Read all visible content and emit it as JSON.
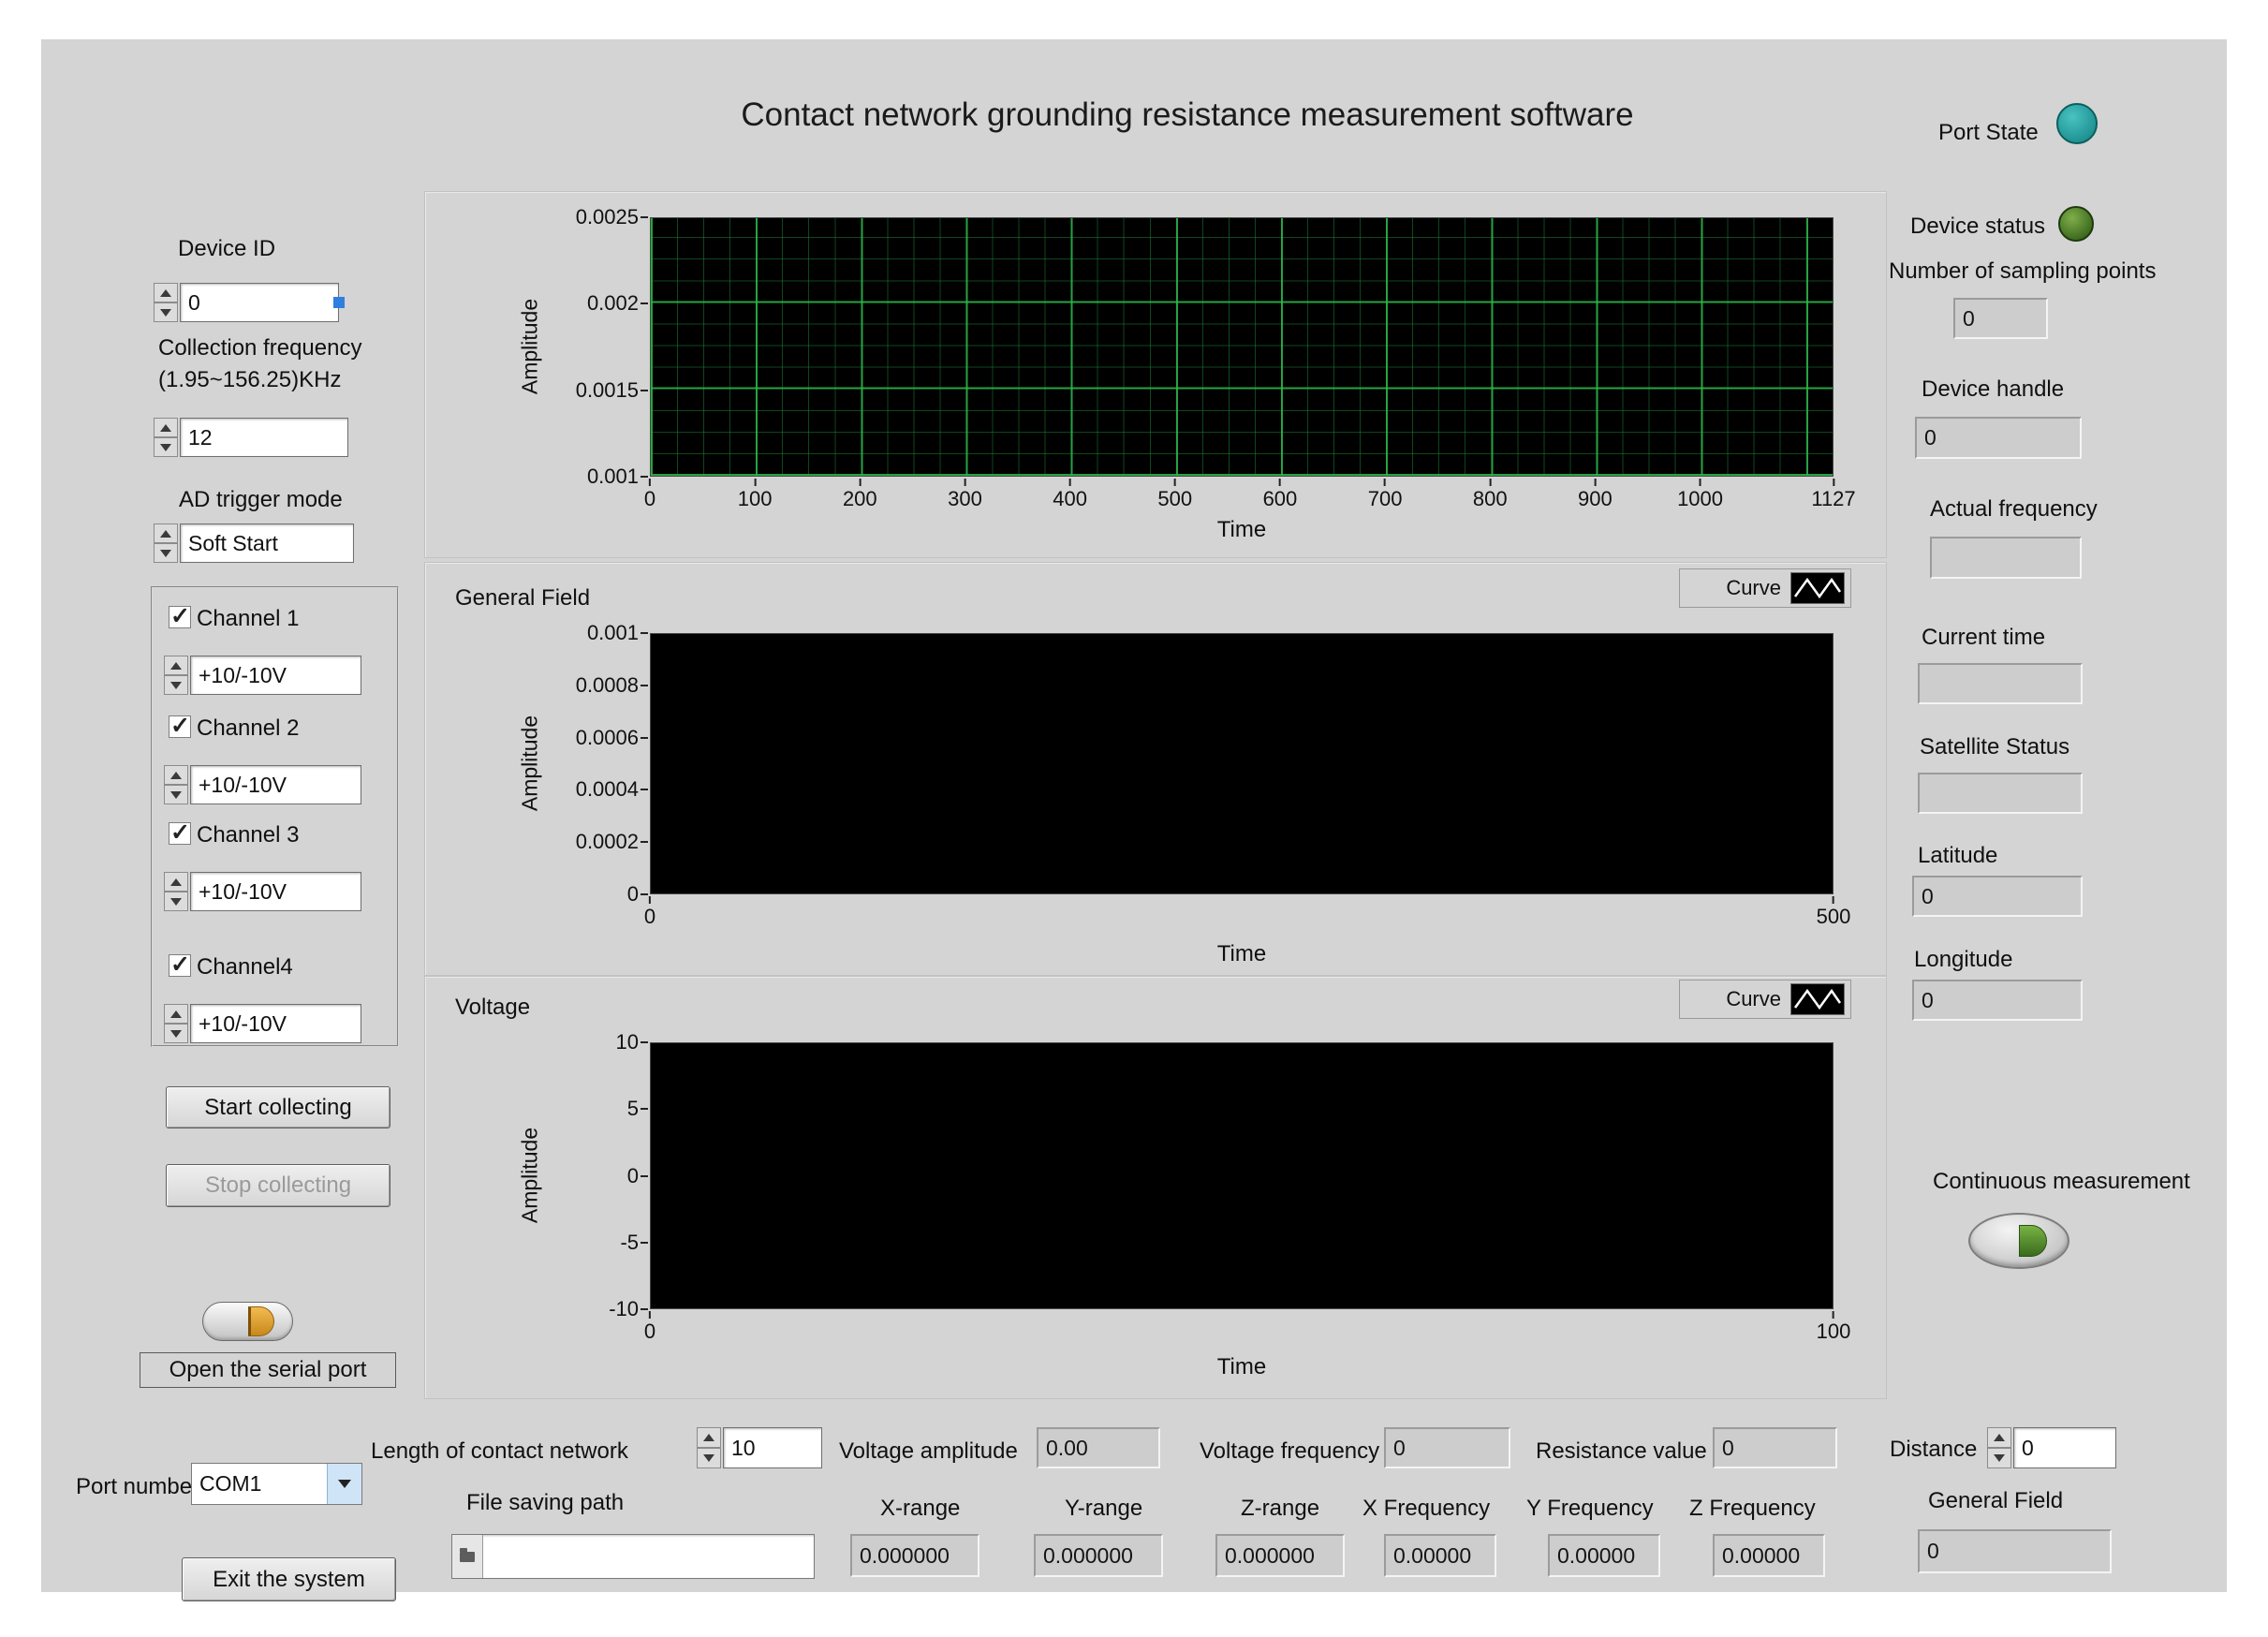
{
  "title": "Contact network grounding resistance measurement software",
  "header": {
    "port_state_label": "Port State"
  },
  "left_panel": {
    "device_id_label": "Device ID",
    "device_id_value": "0",
    "collection_freq_label1": "Collection frequency",
    "collection_freq_label2": "(1.95~156.25)KHz",
    "collection_freq_value": "12",
    "ad_trigger_label": "AD trigger mode",
    "ad_trigger_value": "Soft Start",
    "channels": [
      {
        "label": "Channel 1",
        "checked": true,
        "range": "+10/-10V"
      },
      {
        "label": "Channel 2",
        "checked": true,
        "range": "+10/-10V"
      },
      {
        "label": "Channel 3",
        "checked": true,
        "range": "+10/-10V"
      },
      {
        "label": "Channel4",
        "checked": true,
        "range": "+10/-10V"
      }
    ],
    "start_button_label": "Start collecting",
    "stop_button_label": "Stop collecting",
    "open_serial_label": "Open the serial port",
    "port_number_label": "Port number",
    "port_number_value": "COM1",
    "exit_button_label": "Exit the system"
  },
  "right_panel": {
    "device_status_label": "Device status",
    "sampling_points_label": "Number of sampling points",
    "sampling_points_value": "0",
    "device_handle_label": "Device handle",
    "device_handle_value": "0",
    "actual_frequency_label": "Actual frequency",
    "actual_frequency_value": "",
    "current_time_label": "Current time",
    "current_time_value": "",
    "satellite_status_label": "Satellite Status",
    "satellite_status_value": "",
    "latitude_label": "Latitude",
    "latitude_value": "0",
    "longitude_label": "Longitude",
    "longitude_value": "0",
    "continuous_label": "Continuous measurement",
    "distance_label": "Distance",
    "distance_value": "0",
    "general_field_label": "General Field",
    "general_field_value": "0"
  },
  "bottom_panel": {
    "length_label": "Length of contact network",
    "length_value": "10",
    "voltage_amplitude_label": "Voltage amplitude",
    "voltage_amplitude_value": "0.00",
    "voltage_frequency_label": "Voltage frequency",
    "voltage_frequency_value": "0",
    "resistance_label": "Resistance value",
    "resistance_value": "0",
    "file_path_label": "File saving path",
    "file_path_value": "",
    "ranges": [
      {
        "label": "X-range",
        "value": "0.000000"
      },
      {
        "label": "Y-range",
        "value": "0.000000"
      },
      {
        "label": "Z-range",
        "value": "0.000000"
      },
      {
        "label": "X Frequency",
        "value": "0.00000"
      },
      {
        "label": "Y Frequency",
        "value": "0.00000"
      },
      {
        "label": "Z Frequency",
        "value": "0.00000"
      }
    ]
  },
  "chart_data": [
    {
      "type": "line",
      "title": "",
      "xlabel": "Time",
      "ylabel": "Amplitude",
      "yticks": [
        "0.0025",
        "0.002",
        "0.0015",
        "0.001"
      ],
      "xticks": [
        0,
        100,
        200,
        300,
        400,
        500,
        600,
        700,
        800,
        900,
        1000,
        1127
      ],
      "xlim": [
        0,
        1127
      ],
      "ylim": [
        0.001,
        0.0025
      ],
      "grid": true,
      "plot_bg": "#000000",
      "grid_color": "#1e8a32",
      "series": []
    },
    {
      "type": "line",
      "title": "General Field",
      "legend": "Curve",
      "xlabel": "Time",
      "ylabel": "Amplitude",
      "yticks": [
        "0.001",
        "0.0008",
        "0.0006",
        "0.0004",
        "0.0002",
        "0"
      ],
      "xticks": [
        0,
        500
      ],
      "xlim": [
        0,
        500
      ],
      "ylim": [
        0,
        0.001
      ],
      "grid": false,
      "plot_bg": "#000000",
      "series": []
    },
    {
      "type": "line",
      "title": "Voltage",
      "legend": "Curve",
      "xlabel": "Time",
      "ylabel": "Amplitude",
      "yticks": [
        "10",
        "5",
        "0",
        "-5",
        "-10"
      ],
      "xticks": [
        0,
        100
      ],
      "xlim": [
        0,
        100
      ],
      "ylim": [
        -10,
        10
      ],
      "grid": false,
      "plot_bg": "#000000",
      "series": []
    }
  ]
}
